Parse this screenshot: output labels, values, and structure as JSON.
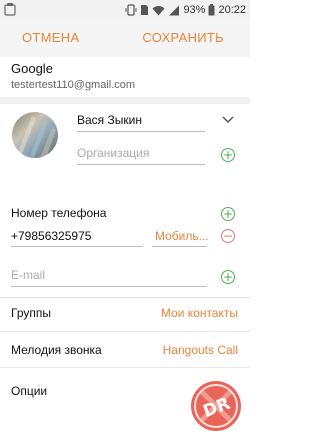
{
  "status": {
    "battery_percent": "93%",
    "time": "20:22",
    "icon_names": [
      "notification-icon",
      "vibrate-icon",
      "sim-icon",
      "wifi-icon",
      "signal-icon",
      "battery-icon"
    ]
  },
  "toolbar": {
    "cancel_label": "ОТМЕНА",
    "save_label": "СОХРАНИТЬ",
    "accent_color": "#e8843a"
  },
  "account": {
    "name": "Google",
    "email": "testertest110@gmail.com"
  },
  "contact": {
    "name_value": "Вася Зыкин",
    "organization_placeholder": "Организация"
  },
  "phone": {
    "label": "Номер телефона",
    "value": "+79856325975",
    "type": "Мобиль..."
  },
  "email": {
    "placeholder": "E-mail"
  },
  "groups": {
    "label": "Группы",
    "value": "Мои контакты"
  },
  "ringtone": {
    "label": "Мелодия звонка",
    "value": "Hangouts Call"
  },
  "options": {
    "label": "Опции"
  },
  "watermark": {
    "text": "DR"
  }
}
